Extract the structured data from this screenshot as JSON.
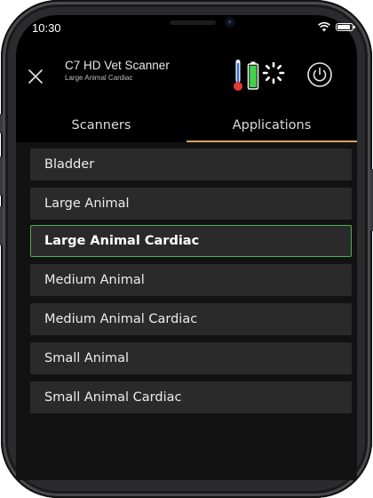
{
  "status_bar": {
    "time": "10:30"
  },
  "header": {
    "title": "C7 HD Vet Scanner",
    "subtitle": "Large Animal Cardiac",
    "icons": [
      "close-icon",
      "thermometer-icon",
      "battery-status-icon",
      "loading-icon",
      "power-icon"
    ]
  },
  "tabs": [
    {
      "label": "Scanners",
      "active": false
    },
    {
      "label": "Applications",
      "active": true
    }
  ],
  "applications": [
    {
      "label": "Bladder",
      "selected": false
    },
    {
      "label": "Large Animal",
      "selected": false
    },
    {
      "label": "Large Animal Cardiac",
      "selected": true
    },
    {
      "label": "Medium Animal",
      "selected": false
    },
    {
      "label": "Medium Animal Cardiac",
      "selected": false
    },
    {
      "label": "Small Animal",
      "selected": false
    },
    {
      "label": "Small Animal Cardiac",
      "selected": false
    }
  ],
  "colors": {
    "accent_tab": "#d9a55b",
    "selected_border": "#4caf50",
    "thermometer_blue": "#2f6fd6",
    "thermometer_red": "#e53935",
    "battery_green": "#43d14a"
  }
}
